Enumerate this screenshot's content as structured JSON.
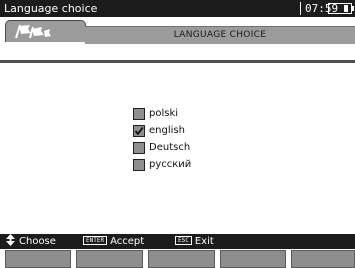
{
  "status_bar": {
    "title": "Language choice",
    "clock": "07:59"
  },
  "header": {
    "title": "LANGUAGE CHOICE",
    "tab_icon": "flags-icon"
  },
  "languages": [
    {
      "label": "polski",
      "checked": false
    },
    {
      "label": "english",
      "checked": true
    },
    {
      "label": "Deutsch",
      "checked": false
    },
    {
      "label": "русский",
      "checked": false
    }
  ],
  "hints": {
    "choose": "Choose",
    "enter_key": "ENTER",
    "accept": "Accept",
    "esc_key": "ESC",
    "exit": "Exit"
  },
  "colors": {
    "bar": "#1c1c1c",
    "panel": "#9b9b9b",
    "function_key": "#8e8e8e"
  }
}
